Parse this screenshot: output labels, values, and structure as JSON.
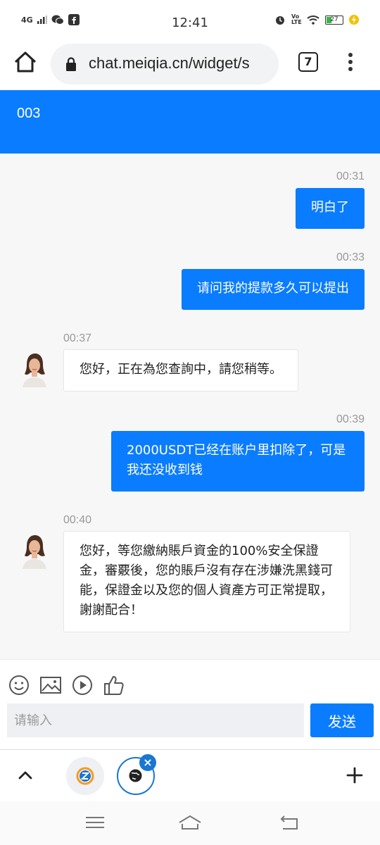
{
  "status_bar": {
    "network": "4G",
    "time": "12:41",
    "volte": "Vo LTE",
    "battery": "27"
  },
  "browser": {
    "url": "chat.meiqia.cn/widget/s",
    "tab_count": "7"
  },
  "chat": {
    "title": "003",
    "messages": [
      {
        "from": "me",
        "time": "00:31",
        "text": "明白了"
      },
      {
        "from": "me",
        "time": "00:33",
        "text": "请问我的提款多久可以提出"
      },
      {
        "from": "agent",
        "time": "00:37",
        "text": "您好，正在為您查詢中，請您稍等。"
      },
      {
        "from": "me",
        "time": "00:39",
        "text": "2000USDT已经在账户里扣除了，可是我还没收到钱"
      },
      {
        "from": "agent",
        "time": "00:40",
        "text": "您好，等您繳納賬戶資金的100%安全保證金，審覈後，您的賬戶沒有存在涉嫌洗黑錢可能，保證金以及您的個人資產方可正常提取，謝謝配合！"
      }
    ]
  },
  "composer": {
    "placeholder": "请输入",
    "send_label": "发送",
    "tools": [
      "emoji-icon",
      "image-icon",
      "video-icon",
      "thumbs-up-icon"
    ]
  },
  "colors": {
    "accent": "#0a7cff",
    "chat_bg": "#f7f7f8"
  }
}
